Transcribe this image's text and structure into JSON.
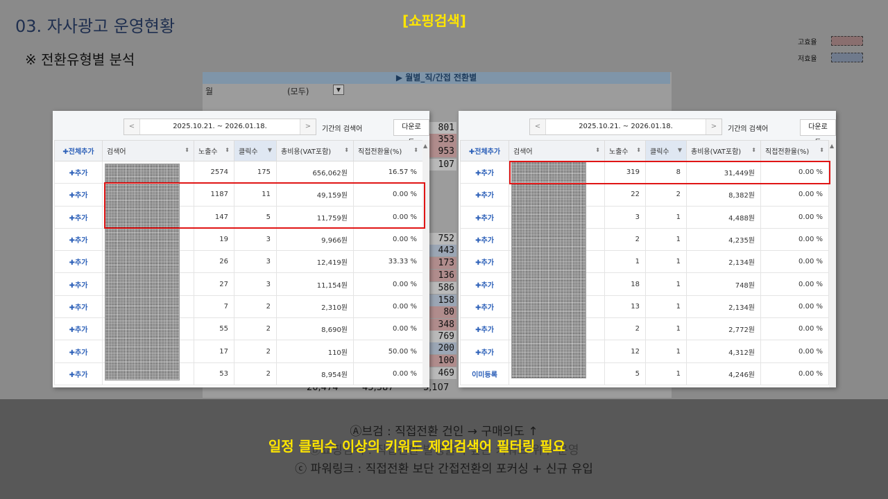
{
  "slide": {
    "title": "03. 자사광고 운영현황",
    "subtitle": "※ 전환유형별 분석",
    "top_label": "[쇼핑검색]"
  },
  "legend": [
    {
      "label": "고효율",
      "color": "#8a6f6f"
    },
    {
      "label": "저효율",
      "color": "#6f7a8c"
    }
  ],
  "background_sheet": {
    "banner": "▶ 월별_직/간접 전환별",
    "filter_label": "월",
    "filter_value": "(모두)",
    "strip_values": [
      "801",
      "353",
      "953",
      "107",
      "",
      "",
      "752",
      "443",
      "173",
      "136",
      "586",
      "158",
      "80",
      "348",
      "769",
      "200",
      "100",
      "469"
    ],
    "bottom_values": [
      "20,474",
      "45,387",
      "5,107"
    ]
  },
  "toolbar": {
    "date_range": "2025.10.21. ~ 2026.01.18.",
    "prev_arrow": "<",
    "next_arrow": ">",
    "term_label": "기간의 검색어",
    "download_label": "다운로드"
  },
  "table_headers": {
    "add_all": "✚전체추가",
    "keyword": "검색어",
    "impressions": "노출수",
    "clicks": "클릭수",
    "cost": "총비용(VAT포함)",
    "conv_rate": "직접전환율(%)"
  },
  "left_table": {
    "rows": [
      {
        "action": "✚추가",
        "impressions": "2574",
        "clicks": "175",
        "cost": "656,062원",
        "conv_rate": "16.57 %"
      },
      {
        "action": "✚추가",
        "impressions": "1187",
        "clicks": "11",
        "cost": "49,159원",
        "conv_rate": "0.00 %"
      },
      {
        "action": "✚추가",
        "impressions": "147",
        "clicks": "5",
        "cost": "11,759원",
        "conv_rate": "0.00 %"
      },
      {
        "action": "✚추가",
        "impressions": "19",
        "clicks": "3",
        "cost": "9,966원",
        "conv_rate": "0.00 %"
      },
      {
        "action": "✚추가",
        "impressions": "26",
        "clicks": "3",
        "cost": "12,419원",
        "conv_rate": "33.33 %"
      },
      {
        "action": "✚추가",
        "impressions": "27",
        "clicks": "3",
        "cost": "11,154원",
        "conv_rate": "0.00 %"
      },
      {
        "action": "✚추가",
        "impressions": "7",
        "clicks": "2",
        "cost": "2,310원",
        "conv_rate": "0.00 %"
      },
      {
        "action": "✚추가",
        "impressions": "55",
        "clicks": "2",
        "cost": "8,690원",
        "conv_rate": "0.00 %"
      },
      {
        "action": "✚추가",
        "impressions": "17",
        "clicks": "2",
        "cost": "110원",
        "conv_rate": "50.00 %"
      },
      {
        "action": "✚추가",
        "impressions": "53",
        "clicks": "2",
        "cost": "8,954원",
        "conv_rate": "0.00 %"
      }
    ]
  },
  "right_table": {
    "rows": [
      {
        "action": "✚추가",
        "impressions": "319",
        "clicks": "8",
        "cost": "31,449원",
        "conv_rate": "0.00 %"
      },
      {
        "action": "✚추가",
        "impressions": "22",
        "clicks": "2",
        "cost": "8,382원",
        "conv_rate": "0.00 %"
      },
      {
        "action": "✚추가",
        "impressions": "3",
        "clicks": "1",
        "cost": "4,488원",
        "conv_rate": "0.00 %"
      },
      {
        "action": "✚추가",
        "impressions": "2",
        "clicks": "1",
        "cost": "4,235원",
        "conv_rate": "0.00 %"
      },
      {
        "action": "✚추가",
        "impressions": "1",
        "clicks": "1",
        "cost": "2,134원",
        "conv_rate": "0.00 %"
      },
      {
        "action": "✚추가",
        "impressions": "18",
        "clicks": "1",
        "cost": "748원",
        "conv_rate": "0.00 %"
      },
      {
        "action": "✚추가",
        "impressions": "13",
        "clicks": "1",
        "cost": "2,134원",
        "conv_rate": "0.00 %"
      },
      {
        "action": "✚추가",
        "impressions": "2",
        "clicks": "1",
        "cost": "2,772원",
        "conv_rate": "0.00 %"
      },
      {
        "action": "✚추가",
        "impressions": "12",
        "clicks": "1",
        "cost": "4,312원",
        "conv_rate": "0.00 %"
      },
      {
        "action": "이미등록",
        "impressions": "5",
        "clicks": "1",
        "cost": "4,246원",
        "conv_rate": "0.00 %"
      }
    ]
  },
  "notes": [
    "Ⓐ브검 : 직접전환 건인 → 구매의도 ↑",
    "Ⓑ쇼핑검색 : 직접전환 발생률이 높은 키워드 위주 운영",
    "ⓒ 파워링크 : 직접전환 보단 간접전환의 포커싱 + 신규 유입"
  ],
  "overlay_message": "일정 클릭수 이상의 키워드 제외검색어 필터링 필요"
}
